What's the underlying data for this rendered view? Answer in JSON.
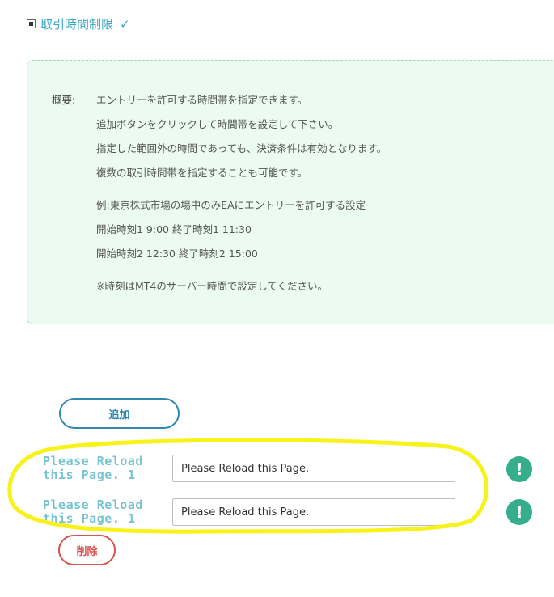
{
  "section": {
    "title": "取引時間制限",
    "check_icon": "check-icon",
    "box_icon": "checkbox-square-icon"
  },
  "info": {
    "label": "概要:",
    "lines": [
      "エントリーを許可する時間帯を指定できます。",
      "追加ボタンをクリックして時間帯を設定して下さい。",
      "指定した範囲外の時間であっても、決済条件は有効となります。",
      "複数の取引時間帯を指定することも可能です。",
      "例:東京株式市場の場中のみEAにエントリーを許可する設定",
      "開始時刻1 9:00 終了時刻1 11:30",
      "開始時刻2 12:30 終了時刻2 15:00",
      "※時刻はMT4のサーバー時間で設定してください。"
    ]
  },
  "buttons": {
    "add_label": "追加",
    "delete_label": "削除"
  },
  "rows": [
    {
      "label_line1": "Please Reload",
      "label_line2": "this Page. 1",
      "input_value": "Please Reload this Page.",
      "alert_icon": "exclamation-icon",
      "alert_symbol": "!"
    },
    {
      "label_line1": "Please Reload",
      "label_line2": "this Page. 1",
      "input_value": "Please Reload this Page.",
      "alert_icon": "exclamation-icon",
      "alert_symbol": "!"
    }
  ],
  "colors": {
    "accent": "#3aa6c4",
    "info_bg": "#ecfbf2",
    "add_button": "#2f88b0",
    "delete_button": "#d9534f",
    "alert": "#36ad8d",
    "highlight": "#f7f219"
  }
}
